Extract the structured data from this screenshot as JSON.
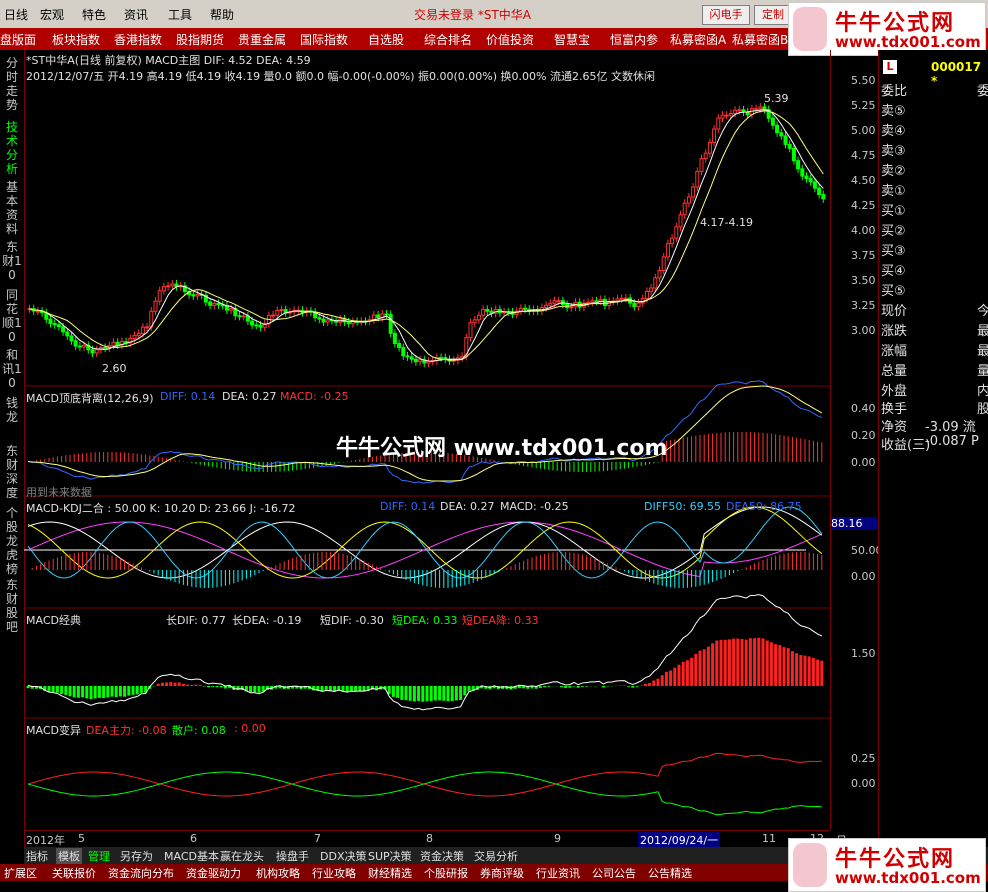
{
  "menu": [
    "日线",
    "宏观",
    "特色",
    "资讯",
    "工具",
    "帮助"
  ],
  "status_text": "交易未登录 *ST中华A",
  "toolbar_buttons": [
    "闪电手",
    "定制"
  ],
  "nav": [
    "盘版面",
    "板块指数",
    "香港指数",
    "股指期货",
    "贵重金属",
    "国际指数",
    "自选股",
    "综合排名",
    "价值投资",
    "智慧宝",
    "恒富内参",
    "私募密函A",
    "私募密函B"
  ],
  "left_tabs": [
    "分时走势",
    "技术分析",
    "基本资料",
    "东财10",
    "同花顺10",
    "和讯10",
    "钱龙",
    "东财深度",
    "个股龙虎榜",
    "东财股吧"
  ],
  "main": {
    "title": "*ST中华A(日线 前复权) MACD主图 DIF: 4.52 DEA: 4.59",
    "info": "2012/12/07/五 开4.19 高4.19 低4.19 收4.19 量0.0 额0.0 幅-0.00(-0.00%) 振0.00(0.00%) 换0.00% 流通2.65亿 文数休闲",
    "ann_high": "5.39",
    "ann_low": "2.60",
    "ann_range": "4.17-4.19",
    "yticks": [
      "5.50",
      "5.25",
      "5.00",
      "4.75",
      "4.50",
      "4.25",
      "4.00",
      "3.75",
      "3.50",
      "3.25",
      "3.00"
    ]
  },
  "panel2": {
    "label": "MACD顶底背离(12,26,9)",
    "diff": "DIFF: 0.14",
    "dea": "DEA: 0.27",
    "macd": "MACD: -0.25",
    "note": "用到未来数据",
    "yticks": [
      "0.40",
      "0.20",
      "0.00"
    ]
  },
  "panel3": {
    "label": "MACD-KDJ二合 : 50.00 K: 10.20 D: 23.66 J: -16.72",
    "diff": "DIFF: 0.14",
    "dea": "DEA: 0.27",
    "macd": "MACD: -0.25",
    "diff50": "DIFF50: 69.55",
    "dea50": "DEA50: 86.75",
    "current": "88.16",
    "yticks": [
      "50.00",
      "0.00"
    ]
  },
  "panel4": {
    "label": "MACD经典",
    "long_dif": "长DIF: 0.77",
    "long_dea": "长DEA: -0.19",
    "short_dif": "短DIF: -0.30",
    "short_dea": "短DEA: 0.33",
    "short_dea_fall": "短DEA降: 0.33",
    "yticks": [
      "1.50"
    ]
  },
  "panel5": {
    "label": "MACD变异",
    "main": "DEA主力: -0.08",
    "retail": "散户: 0.08",
    "extra": ": 0.00",
    "yticks": [
      "0.25",
      "0.00"
    ]
  },
  "dates": [
    "2012年",
    "5",
    "6",
    "7",
    "8",
    "9",
    "2012/09/24/一",
    "11",
    "12",
    "日线"
  ],
  "quote": {
    "code": "000017 *",
    "rows": [
      {
        "label": "委比",
        "val": "委"
      },
      {
        "label": "卖⑤",
        "val": ""
      },
      {
        "label": "卖④",
        "val": ""
      },
      {
        "label": "卖③",
        "val": ""
      },
      {
        "label": "卖②",
        "val": ""
      },
      {
        "label": "卖①",
        "val": ""
      },
      {
        "label": "买①",
        "val": ""
      },
      {
        "label": "买②",
        "val": ""
      },
      {
        "label": "买③",
        "val": ""
      },
      {
        "label": "买④",
        "val": ""
      },
      {
        "label": "买⑤",
        "val": ""
      },
      {
        "label": "现价",
        "val": "今"
      },
      {
        "label": "涨跌",
        "val": "最"
      },
      {
        "label": "涨幅",
        "val": "最"
      },
      {
        "label": "总量",
        "val": "量"
      },
      {
        "label": "外盘",
        "val": "内"
      },
      {
        "label": "换手",
        "val": "股"
      },
      {
        "label": "净资",
        "val": "-3.09 流"
      },
      {
        "label": "收益(三)",
        "val": "-0.087 P"
      }
    ]
  },
  "bottom_tabs": [
    "指标",
    "模板",
    "管理",
    "另存为",
    "MACD基本",
    "赢在龙头",
    "操盘手",
    "DDX决策",
    "SUP决策",
    "资金决策",
    "交易分析"
  ],
  "bottom_tabs2": [
    "扩展区",
    "关联报价",
    "资金流向分布",
    "资金驱动力",
    "机构攻略",
    "行业攻略",
    "财经精选",
    "个股研报",
    "券商评级",
    "行业资讯",
    "公司公告",
    "公告精选"
  ],
  "watermark": "牛牛公式网 www.tdx001.com",
  "logo": {
    "title": "牛牛公式网",
    "url": "www.tdx001.com"
  },
  "colors": {
    "up": "#ff3232",
    "down": "#00ff00",
    "frame": "#7a0000",
    "nav": "#b00000"
  }
}
